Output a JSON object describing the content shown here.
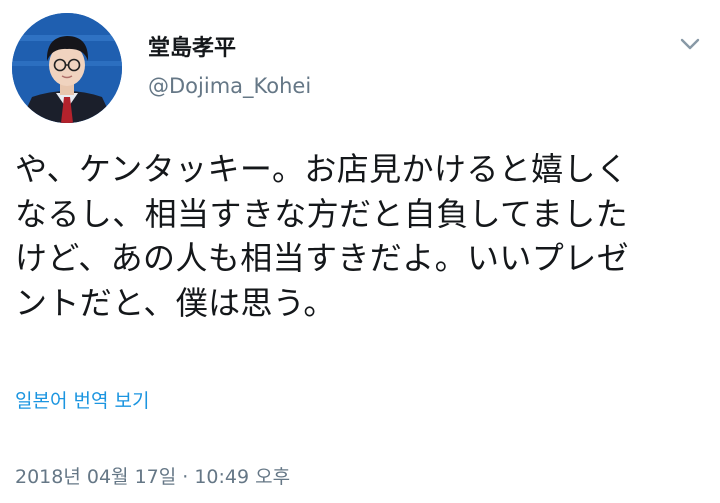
{
  "tweet": {
    "display_name": "堂島孝平",
    "handle": "@Dojima_Kohei",
    "text": "や、ケンタッキー。お店見かけると嬉しく\nなるし、相当すきな方だと自負してました\nけど、あの人も相当すきだよ。いいプレゼ\nントだと、僕は思う。",
    "translate_label": "일본어 번역 보기",
    "timestamp": "2018년 04월 17일 · 10:49 오후"
  },
  "icons": {
    "avatar": "profile-photo",
    "menu": "chevron-down-icon"
  },
  "colors": {
    "text_primary": "#14171a",
    "text_secondary": "#657786",
    "link": "#1b95e0",
    "background": "#ffffff"
  }
}
